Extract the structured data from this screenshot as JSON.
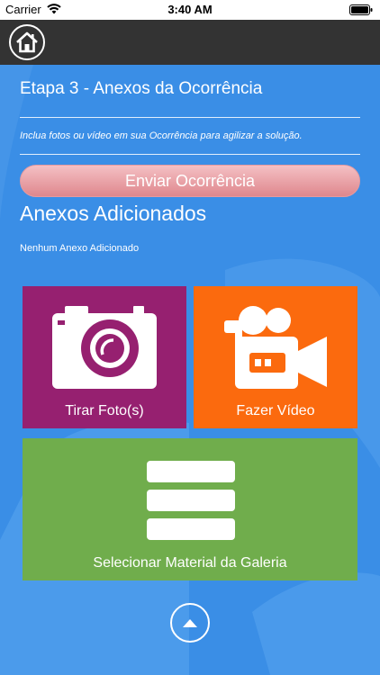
{
  "status_bar": {
    "carrier": "Carrier",
    "time": "3:40 AM"
  },
  "header": {
    "home_icon": "home-icon"
  },
  "step": {
    "title": "Etapa 3 - Anexos da Ocorrência",
    "subtitle": "Inclua fotos ou vídeo em sua Ocorrência para agilizar a solução."
  },
  "send_button": {
    "label": "Enviar Ocorrência"
  },
  "attachments": {
    "title": "Anexos Adicionados",
    "empty_text": "Nenhum Anexo Adicionado"
  },
  "tiles": {
    "photo": {
      "label": "Tirar Foto(s)",
      "icon": "camera-icon",
      "color": "#962070"
    },
    "video": {
      "label": "Fazer Vídeo",
      "icon": "video-camera-icon",
      "color": "#fb6a0e"
    },
    "gallery": {
      "label": "Selecionar Material da Galeria",
      "icon": "gallery-list-icon",
      "color": "#70ad4c"
    }
  },
  "scroll_up": {
    "icon": "chevron-up-icon"
  },
  "colors": {
    "background": "#3a8ee6",
    "header": "#333333",
    "send_button": "#df878d"
  }
}
